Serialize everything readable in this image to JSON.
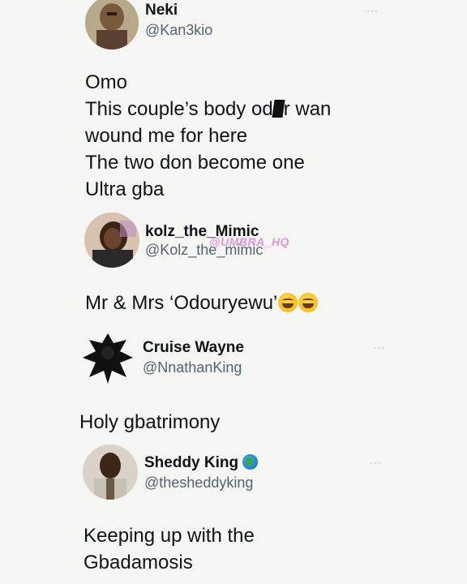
{
  "posts": [
    {
      "name": "Neki",
      "handle": "@Kan3kio",
      "more": "···",
      "body": [
        "Omo",
        "This couple’s body od",
        "r wan",
        "wound me for here",
        "The two don become one",
        "Ultra gba"
      ]
    },
    {
      "name": "kolz_the_Mimic",
      "handle": "@Kolz_the_mimic",
      "watermark": "@UMBRA_HQ",
      "body": [
        "Mr & Mrs ‘Odouryewu’"
      ]
    },
    {
      "name": "Cruise Wayne",
      "handle": "@NnathanKing",
      "more": "···",
      "body": [
        "Holy gbatrimony"
      ]
    },
    {
      "name": "Sheddy King",
      "handle": "@thesheddyking",
      "more": "···",
      "body": [
        "Keeping up with the",
        "Gbadamosis"
      ]
    }
  ]
}
